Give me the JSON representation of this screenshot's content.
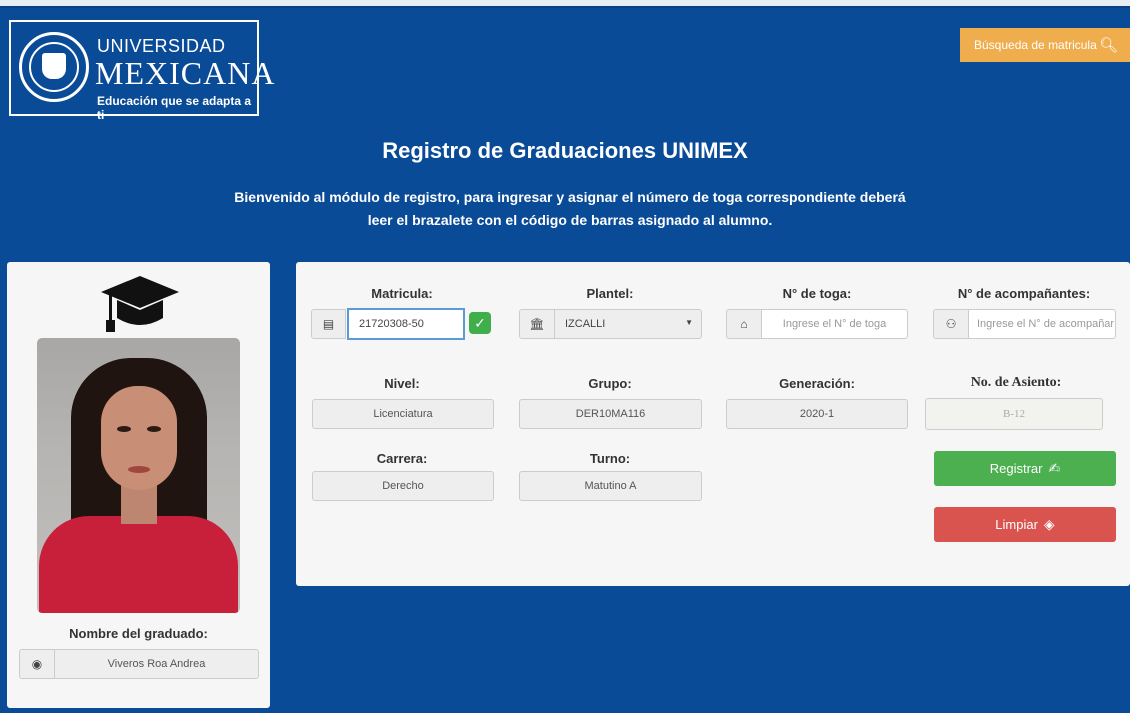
{
  "logo": {
    "line1": "UNIVERSIDAD",
    "line2": "MEXICANA",
    "tagline": "Educación que se adapta a ti"
  },
  "header": {
    "search_label": "Búsqueda de matricula",
    "search_icon": "search-icon",
    "title": "Registro de Graduaciones UNIMEX",
    "subtitle": "Bienvenido al módulo de registro, para ingresar y asignar el número de toga correspondiente deberá leer el brazalete con el código de barras asignado al alumno."
  },
  "student": {
    "cap_icon": "graduation-cap-icon",
    "name_label": "Nombre del graduado:",
    "name_value": "Viveros Roa Andrea",
    "name_icon": "user-circle-icon"
  },
  "form": {
    "matricula": {
      "label": "Matricula:",
      "value": "21720308-50",
      "icon": "id-card-icon",
      "status_icon": "check-circle-icon"
    },
    "plantel": {
      "label": "Plantel:",
      "value": "IZCALLI",
      "icon": "building-columns-icon"
    },
    "toga": {
      "label": "N° de toga:",
      "placeholder": "Ingrese el N° de toga",
      "icon": "graduation-cap-icon"
    },
    "acompanantes": {
      "label": "N° de acompañantes:",
      "placeholder": "Ingrese el N° de acompañar",
      "icon": "users-icon"
    },
    "nivel": {
      "label": "Nivel:",
      "value": "Licenciatura"
    },
    "grupo": {
      "label": "Grupo:",
      "value": "DER10MA116"
    },
    "generacion": {
      "label": "Generación:",
      "value": "2020-1"
    },
    "asiento": {
      "label": "No. de Asiento:",
      "value": "B-12"
    },
    "carrera": {
      "label": "Carrera:",
      "value": "Derecho"
    },
    "turno": {
      "label": "Turno:",
      "value": "Matutino A"
    },
    "register_label": "Registrar",
    "clear_label": "Limpiar"
  },
  "colors": {
    "background": "#0a4b97",
    "search_button": "#f0ad4e",
    "register_button": "#4cb050",
    "clear_button": "#d9534f",
    "valid_check": "#3fae4b"
  }
}
